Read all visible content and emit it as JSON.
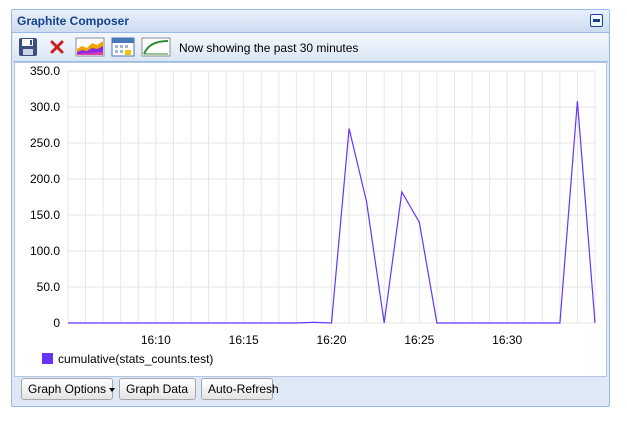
{
  "panel": {
    "title": "Graphite Composer"
  },
  "toolbar": {
    "status_text": "Now showing the past 30 minutes",
    "icons": [
      "save-icon",
      "delete-icon",
      "graph-options-icon",
      "calendar-icon",
      "relative-time-icon"
    ]
  },
  "footer": {
    "graph_options_label": "Graph Options",
    "graph_data_label": "Graph Data",
    "auto_refresh_label": "Auto-Refresh"
  },
  "colors": {
    "series": "#6633ff",
    "header_text": "#15428b",
    "panel_bg": "#dfe8f6",
    "delete_red": "#cc2020"
  },
  "chart_data": {
    "type": "line",
    "title": "",
    "xlabel": "",
    "ylabel": "",
    "ylim": [
      0,
      350
    ],
    "xlim": [
      "16:05",
      "16:35"
    ],
    "yticks": [
      "0",
      "50.0",
      "100.0",
      "150.0",
      "200.0",
      "250.0",
      "300.0",
      "350.0"
    ],
    "xticks": [
      "16:10",
      "16:15",
      "16:20",
      "16:25",
      "16:30"
    ],
    "grid": true,
    "legend": "bottom-left",
    "series": [
      {
        "name": "cumulative(stats_counts.test)",
        "x": [
          "16:05",
          "16:06",
          "16:07",
          "16:08",
          "16:09",
          "16:10",
          "16:11",
          "16:12",
          "16:13",
          "16:14",
          "16:15",
          "16:16",
          "16:17",
          "16:18",
          "16:19",
          "16:20",
          "16:21",
          "16:22",
          "16:23",
          "16:24",
          "16:25",
          "16:26",
          "16:27",
          "16:28",
          "16:29",
          "16:30",
          "16:31",
          "16:32",
          "16:33",
          "16:34",
          "16:35"
        ],
        "values": [
          0,
          0,
          0,
          0,
          0,
          0,
          0,
          0,
          0,
          0,
          0,
          0,
          0,
          0,
          1,
          0,
          270,
          168,
          0,
          182,
          140,
          0,
          0,
          0,
          0,
          0,
          0,
          0,
          0,
          308,
          0
        ]
      }
    ]
  }
}
